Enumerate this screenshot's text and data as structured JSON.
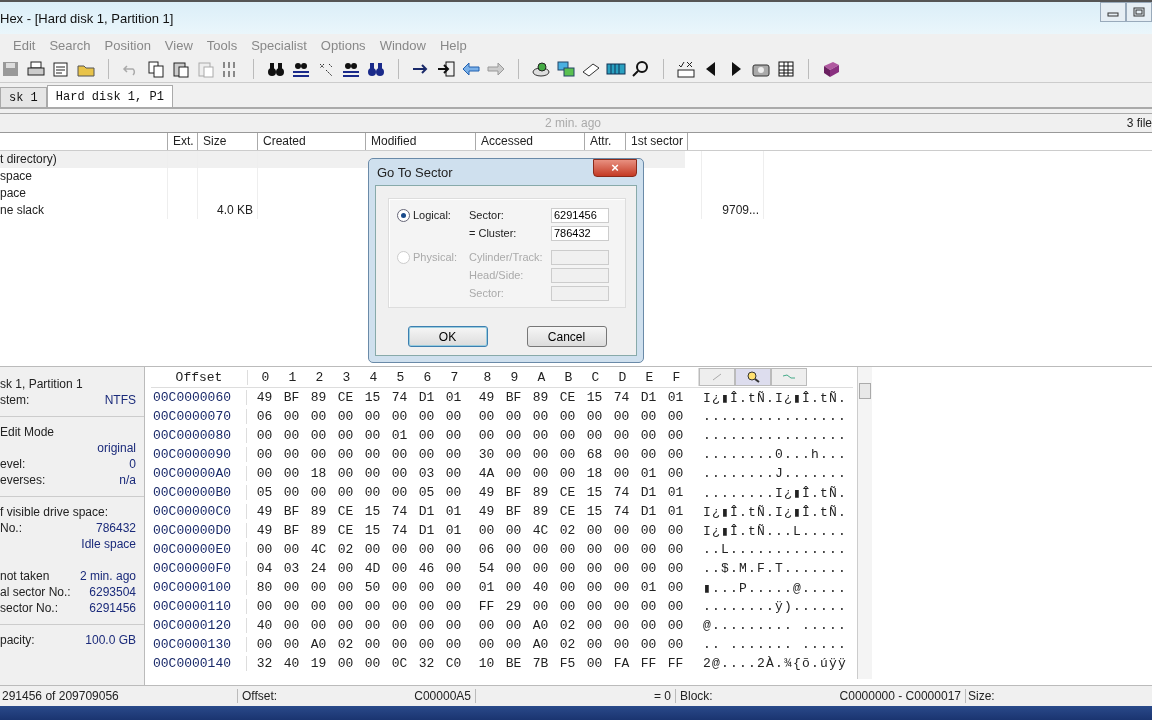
{
  "window": {
    "title": "Hex - [Hard disk 1, Partition 1]"
  },
  "menu": [
    "Edit",
    "Search",
    "Position",
    "View",
    "Tools",
    "Specialist",
    "Options",
    "Window",
    "Help"
  ],
  "tabs": [
    {
      "label": "sk 1",
      "selected": false
    },
    {
      "label": "Hard disk 1, P1",
      "selected": true
    }
  ],
  "info_bar": {
    "time": "2 min. ago",
    "count": "3 file"
  },
  "file_list": {
    "columns": [
      "Ext.",
      "Size",
      "Created",
      "Modified",
      "Accessed",
      "Attr.",
      "1st sector"
    ],
    "rows": [
      {
        "name": "t directory)"
      },
      {
        "name": "space"
      },
      {
        "name": "pace"
      },
      {
        "name": "ne slack",
        "size": "4.0 KB",
        "first_sector": "9709..."
      }
    ]
  },
  "info_panel": [
    {
      "label": "sk 1, Partition 1"
    },
    {
      "label": "stem:",
      "value": "NTFS"
    },
    {
      "kind": "divider"
    },
    {
      "label": "Edit Mode"
    },
    {
      "value": "original"
    },
    {
      "label": "evel:",
      "value": "0"
    },
    {
      "label": "everses:",
      "value": "n/a"
    },
    {
      "kind": "divider"
    },
    {
      "label": "f visible drive space:"
    },
    {
      "label": "No.:",
      "value": "786432"
    },
    {
      "value": "Idle space"
    },
    {
      "kind": "gap"
    },
    {
      "label": "not taken",
      "value": "2 min. ago"
    },
    {
      "label": "al sector No.:",
      "value": "6293504"
    },
    {
      "label": "sector No.:",
      "value": "6291456"
    },
    {
      "kind": "divider"
    },
    {
      "label": "pacity:",
      "value": "100.0 GB"
    }
  ],
  "hex": {
    "offset_heading": "Offset",
    "columns": [
      "0",
      "1",
      "2",
      "3",
      "4",
      "5",
      "6",
      "7",
      "8",
      "9",
      "A",
      "B",
      "C",
      "D",
      "E",
      "F"
    ],
    "rows": [
      {
        "offset": "00C0000060",
        "bytes": [
          "49",
          "BF",
          "89",
          "CE",
          "15",
          "74",
          "D1",
          "01",
          "49",
          "BF",
          "89",
          "CE",
          "15",
          "74",
          "D1",
          "01"
        ],
        "text": "I¿▮Î.tÑ.I¿▮Î.tÑ."
      },
      {
        "offset": "00C0000070",
        "bytes": [
          "06",
          "00",
          "00",
          "00",
          "00",
          "00",
          "00",
          "00",
          "00",
          "00",
          "00",
          "00",
          "00",
          "00",
          "00",
          "00"
        ],
        "text": "................"
      },
      {
        "offset": "00C0000080",
        "bytes": [
          "00",
          "00",
          "00",
          "00",
          "00",
          "01",
          "00",
          "00",
          "00",
          "00",
          "00",
          "00",
          "00",
          "00",
          "00",
          "00"
        ],
        "text": "................"
      },
      {
        "offset": "00C0000090",
        "bytes": [
          "00",
          "00",
          "00",
          "00",
          "00",
          "00",
          "00",
          "00",
          "30",
          "00",
          "00",
          "00",
          "68",
          "00",
          "00",
          "00"
        ],
        "text": "........0...h..."
      },
      {
        "offset": "00C00000A0",
        "bytes": [
          "00",
          "00",
          "18",
          "00",
          "00",
          "00",
          "03",
          "00",
          "4A",
          "00",
          "00",
          "00",
          "18",
          "00",
          "01",
          "00"
        ],
        "text": "........J......."
      },
      {
        "offset": "00C00000B0",
        "bytes": [
          "05",
          "00",
          "00",
          "00",
          "00",
          "00",
          "05",
          "00",
          "49",
          "BF",
          "89",
          "CE",
          "15",
          "74",
          "D1",
          "01"
        ],
        "text": "........I¿▮Î.tÑ."
      },
      {
        "offset": "00C00000C0",
        "bytes": [
          "49",
          "BF",
          "89",
          "CE",
          "15",
          "74",
          "D1",
          "01",
          "49",
          "BF",
          "89",
          "CE",
          "15",
          "74",
          "D1",
          "01"
        ],
        "text": "I¿▮Î.tÑ.I¿▮Î.tÑ."
      },
      {
        "offset": "00C00000D0",
        "bytes": [
          "49",
          "BF",
          "89",
          "CE",
          "15",
          "74",
          "D1",
          "01",
          "00",
          "00",
          "4C",
          "02",
          "00",
          "00",
          "00",
          "00"
        ],
        "text": "I¿▮Î.tÑ...L....."
      },
      {
        "offset": "00C00000E0",
        "bytes": [
          "00",
          "00",
          "4C",
          "02",
          "00",
          "00",
          "00",
          "00",
          "06",
          "00",
          "00",
          "00",
          "00",
          "00",
          "00",
          "00"
        ],
        "text": "..L............."
      },
      {
        "offset": "00C00000F0",
        "bytes": [
          "04",
          "03",
          "24",
          "00",
          "4D",
          "00",
          "46",
          "00",
          "54",
          "00",
          "00",
          "00",
          "00",
          "00",
          "00",
          "00"
        ],
        "text": "..$.M.F.T......."
      },
      {
        "offset": "00C0000100",
        "bytes": [
          "80",
          "00",
          "00",
          "00",
          "50",
          "00",
          "00",
          "00",
          "01",
          "00",
          "40",
          "00",
          "00",
          "00",
          "01",
          "00"
        ],
        "text": "▮...P.....@....."
      },
      {
        "offset": "00C0000110",
        "bytes": [
          "00",
          "00",
          "00",
          "00",
          "00",
          "00",
          "00",
          "00",
          "FF",
          "29",
          "00",
          "00",
          "00",
          "00",
          "00",
          "00"
        ],
        "text": "........ÿ)......"
      },
      {
        "offset": "00C0000120",
        "bytes": [
          "40",
          "00",
          "00",
          "00",
          "00",
          "00",
          "00",
          "00",
          "00",
          "00",
          "A0",
          "02",
          "00",
          "00",
          "00",
          "00"
        ],
        "text": "@......... ....."
      },
      {
        "offset": "00C0000130",
        "bytes": [
          "00",
          "00",
          "A0",
          "02",
          "00",
          "00",
          "00",
          "00",
          "00",
          "00",
          "A0",
          "02",
          "00",
          "00",
          "00",
          "00"
        ],
        "text": ".. ....... ....."
      },
      {
        "offset": "00C0000140",
        "bytes": [
          "32",
          "40",
          "19",
          "00",
          "00",
          "0C",
          "32",
          "C0",
          "10",
          "BE",
          "7B",
          "F5",
          "00",
          "FA",
          "FF",
          "FF"
        ],
        "text": "2@....2À.¾{õ.úÿÿ"
      }
    ]
  },
  "status_bar": {
    "position": "291456 of 209709056",
    "offset_label": "Offset:",
    "offset": "C00000A5",
    "value": "= 0",
    "block_label": "Block:",
    "block": "C0000000 - C0000017",
    "size_label": "Size:"
  },
  "dialog": {
    "title": "Go To Sector",
    "close": "×",
    "modes": [
      {
        "label": "Logical:",
        "selected": true,
        "disabled": false,
        "fields": [
          {
            "label": "Sector:",
            "value": "6291456"
          },
          {
            "label": "= Cluster:",
            "value": "786432"
          }
        ]
      },
      {
        "label": "Physical:",
        "selected": false,
        "disabled": true,
        "fields": [
          {
            "label": "Cylinder/Track:"
          },
          {
            "label": "Head/Side:"
          },
          {
            "label": "Sector:"
          }
        ]
      }
    ],
    "buttons": [
      "OK",
      "Cancel"
    ]
  }
}
